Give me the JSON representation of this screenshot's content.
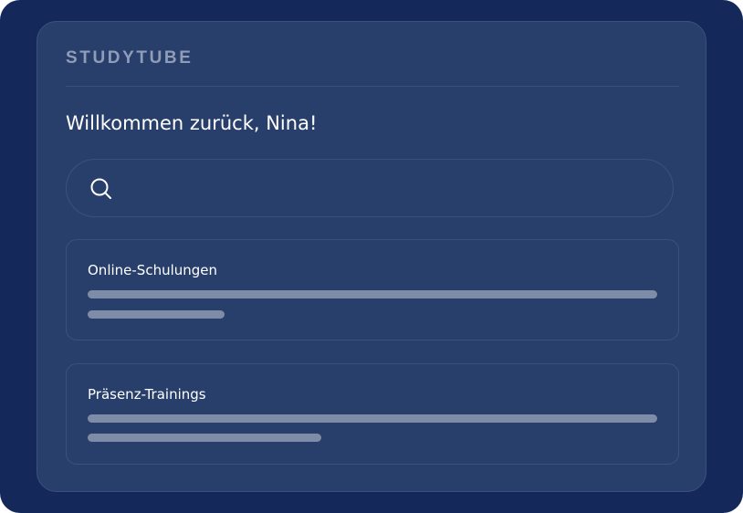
{
  "brand": {
    "logo_text": "STUDYTUBE"
  },
  "welcome": {
    "heading": "Willkommen zurück, Nina!"
  },
  "search": {
    "icon": "search-icon",
    "value": "",
    "placeholder": ""
  },
  "cards": [
    {
      "title": "Online-Schulungen"
    },
    {
      "title": "Präsenz-Trainings"
    }
  ],
  "colors": {
    "frame_background": "#14295a",
    "panel_background": "#293f6b",
    "border": "#3c5080",
    "logo": "#8f9db9",
    "placeholder_bar": "#7f8ca8",
    "text": "#ffffff"
  }
}
